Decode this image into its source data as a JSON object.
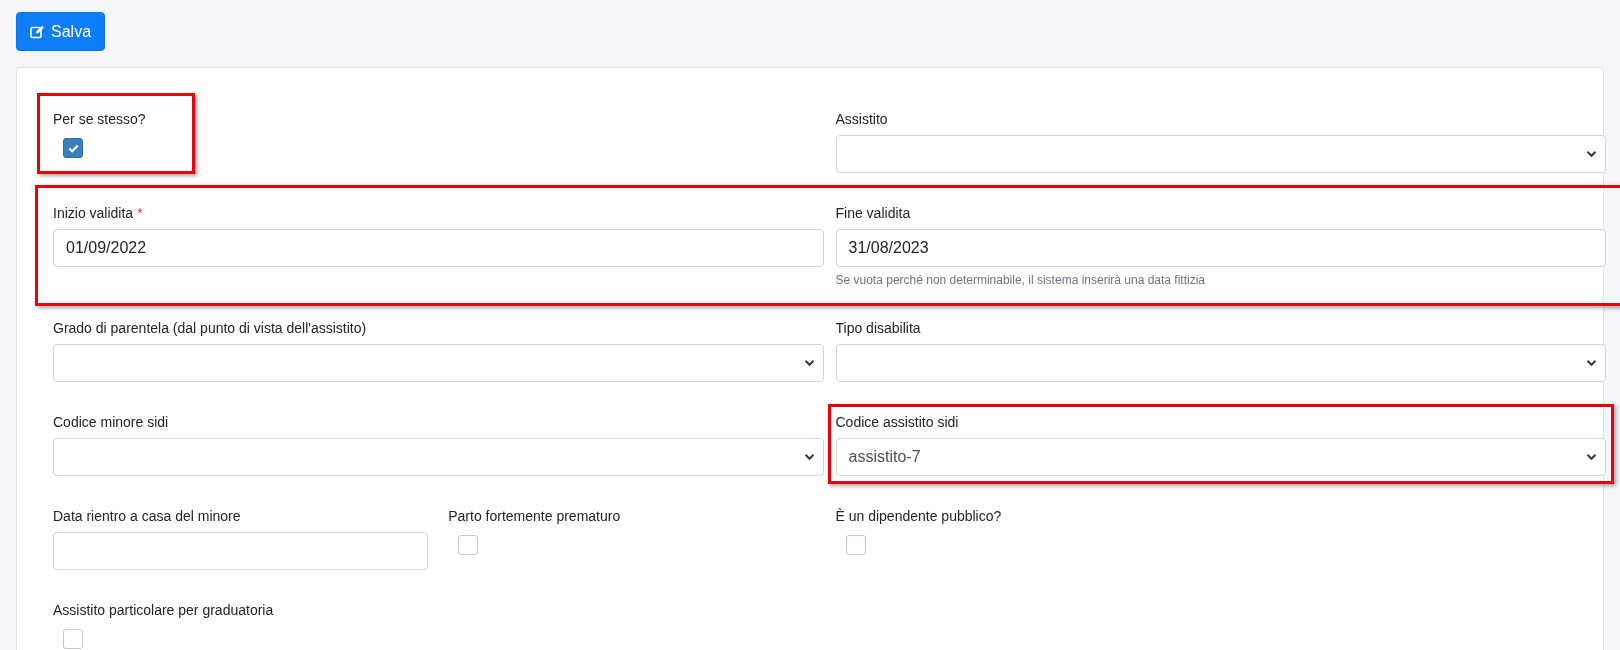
{
  "toolbar": {
    "save_button": "Salva"
  },
  "rows": [
    {
      "highlighted": false,
      "left": [
        {
          "kind": "checkbox",
          "label": "Per se stesso?",
          "checked": true,
          "highlighted": true
        }
      ],
      "right": [
        {
          "kind": "select",
          "label": "Assistito",
          "highlighted": false
        }
      ]
    },
    {
      "highlighted": true,
      "left": [
        {
          "kind": "text",
          "label": "Inizio validita",
          "required_mark": "*",
          "value": "01/09/2022",
          "highlighted": false
        }
      ],
      "right": [
        {
          "kind": "text",
          "label": "Fine validita",
          "value": "31/08/2023",
          "help": "Se vuota perché non determinabile, il sistema inserirà una data fittizia",
          "highlighted": false
        }
      ]
    },
    {
      "highlighted": false,
      "left": [
        {
          "kind": "select",
          "label": "Grado di parentela (dal punto di vista dell'assistito)",
          "highlighted": false
        }
      ],
      "right": [
        {
          "kind": "select",
          "label": "Tipo disabilita",
          "highlighted": false
        }
      ]
    },
    {
      "highlighted": false,
      "left": [
        {
          "kind": "select",
          "label": "Codice minore sidi",
          "highlighted": false
        }
      ],
      "right": [
        {
          "kind": "select",
          "label": "Codice assistito sidi",
          "value": "assistito-7",
          "highlighted": true
        }
      ]
    },
    {
      "highlighted": false,
      "left": [
        {
          "kind": "text",
          "label": "Data rientro a casa del minore",
          "highlighted": false
        },
        {
          "kind": "checkbox",
          "label": "Parto fortemente prematuro",
          "checked": false,
          "highlighted": false
        }
      ],
      "right": [
        {
          "kind": "checkbox",
          "label": "È un dipendente pubblico?",
          "checked": false,
          "highlighted": false
        }
      ]
    },
    {
      "highlighted": false,
      "left": [
        {
          "kind": "checkbox",
          "label": "Assistito particolare per graduatoria",
          "checked": false,
          "highlighted": false
        }
      ],
      "right": []
    }
  ]
}
